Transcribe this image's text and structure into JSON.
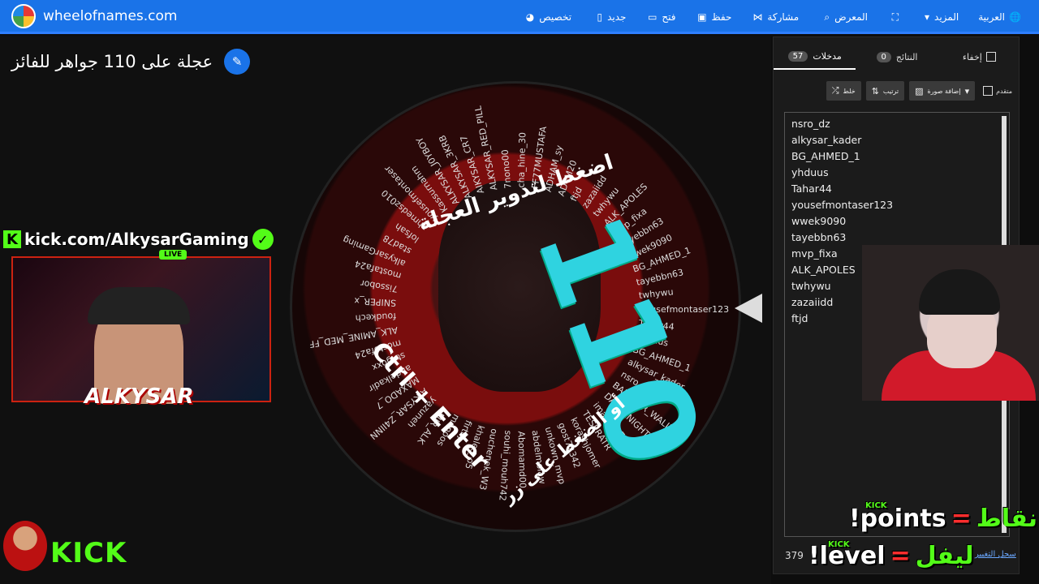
{
  "topbar": {
    "site": "wheelofnames.com",
    "menu": [
      {
        "label": "العربية",
        "icon": "globe-icon"
      },
      {
        "label": "المزيد",
        "icon": "caret-down-icon"
      },
      {
        "label": "",
        "icon": "fullscreen-icon"
      },
      {
        "label": "المعرض",
        "icon": "search-icon"
      },
      {
        "label": "مشاركة",
        "icon": "share-icon"
      },
      {
        "label": "حفظ",
        "icon": "save-icon"
      },
      {
        "label": "فتح",
        "icon": "folder-icon"
      },
      {
        "label": "جديد",
        "icon": "file-icon"
      },
      {
        "label": "تخصيص",
        "icon": "palette-icon"
      }
    ]
  },
  "wheel": {
    "title": "عجلة على 110 جواهر للفائز",
    "spin_hint": "اضغط لتدوير العجلة",
    "ctrl_hint": "Ctrl + Enter",
    "ctrl_hint_ar": "أو الضغط على زر",
    "big_number": "110",
    "names": [
      "yousefmontaser123",
      "Tahar44",
      "yhduus",
      "BG_AHMED_1",
      "alkysar_kader",
      "nsro_dz",
      "BARKSAR_WALID",
      "DARKKNIGHT",
      "iman_127",
      "TESERATR",
      "korashjomer",
      "gost72342",
      "unkown_mvp",
      "abdelmolaw",
      "Abomamd00",
      "souhi_mouh742",
      "ouchenek_W3",
      "khaled_o5",
      "firthj",
      "monoos",
      "AMIR_ALK",
      "yazuneh",
      "AIKYSAR_Z4IINN",
      "MAXADO_7",
      "abdelkadir",
      "stngoxx",
      "mostofa24",
      "ALK_AMINE_MED_FF",
      "foudkech",
      "SNIPER_x",
      "7issobor",
      "mostafa24",
      "alkysarGaming",
      "stad78",
      "lofsah",
      "ahmedsz010",
      "yousefmontaser",
      "Kassurnahm",
      "ALKYSAR_J0YBOY",
      "ALKYSAR_3KRB",
      "AIKYSAR_CR7",
      "ALKYSAR_RED_PILL",
      "7nono00",
      "cha_hine_30",
      "FF77MUSTAFA",
      "ADHAM_sy",
      "AD4M20",
      "ftjd",
      "zazaiidd",
      "twhywu",
      "ALK_APOLES",
      "mvp_fixa",
      "tayebbn63",
      "wwek9090",
      "BG_AHMED_1",
      "tayebbn63",
      "twhywu"
    ]
  },
  "streamer": {
    "kick_letter": "K",
    "url": "kick.com/AlkysarGaming",
    "live": "LIVE",
    "name": "ALKYSAR",
    "kick_brand": "KICK"
  },
  "panel": {
    "tabs": [
      {
        "label": "إخفاء",
        "count": null
      },
      {
        "label": "النتائج",
        "count": "0"
      },
      {
        "label": "مدخلات",
        "count": "57"
      }
    ],
    "toolbar": {
      "advanced": "متقدم",
      "add_image": "إضافة صورة",
      "sort": "ترتيب",
      "shuffle": "خلط"
    },
    "entries": [
      "nsro_dz",
      "alkysar_kader",
      "BG_AHMED_1",
      "yhduus",
      "Tahar44",
      "yousefmontaser123",
      "wwek9090",
      "tayebbn63",
      "mvp_fixa",
      "ALK_APOLES",
      "twhywu",
      "zazaiidd",
      "ftjd"
    ],
    "footer_number": "379",
    "footer_link": "سجل التغيير"
  },
  "overlay": {
    "points": {
      "ar": "نقاط",
      "eq": "=",
      "en": "!points",
      "tag": "KICK"
    },
    "level": {
      "ar": "ليفل",
      "eq": "=",
      "en": "!level",
      "tag": "KICK"
    }
  },
  "colors": {
    "accent": "#1a73e8",
    "kick_green": "#53fc18",
    "cyan": "#2fd3e0"
  }
}
